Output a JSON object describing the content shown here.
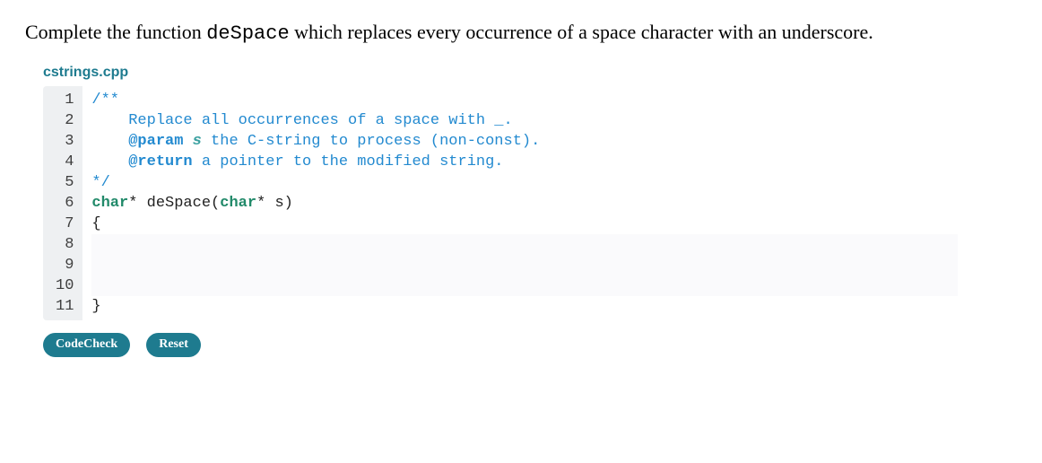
{
  "prompt": {
    "prefix": "Complete the function ",
    "func": "deSpace",
    "suffix": " which replaces every occurrence of a space character with an underscore."
  },
  "filename": "cstrings.cpp",
  "lines": [
    {
      "n": "1",
      "edit": false,
      "tokens": [
        {
          "cls": "tok-comment",
          "t": "/**"
        }
      ]
    },
    {
      "n": "2",
      "edit": false,
      "tokens": [
        {
          "cls": "tok-comment",
          "t": "    Replace all occurrences of a space with _."
        }
      ]
    },
    {
      "n": "3",
      "edit": false,
      "tokens": [
        {
          "cls": "tok-comment",
          "t": "    "
        },
        {
          "cls": "tok-docstrong",
          "t": "@param"
        },
        {
          "cls": "tok-comment",
          "t": " "
        },
        {
          "cls": "tok-doccode",
          "t": "s"
        },
        {
          "cls": "tok-comment",
          "t": " the C-string to process (non-const)."
        }
      ]
    },
    {
      "n": "4",
      "edit": false,
      "tokens": [
        {
          "cls": "tok-comment",
          "t": "    "
        },
        {
          "cls": "tok-docstrong",
          "t": "@return"
        },
        {
          "cls": "tok-comment",
          "t": " a pointer to the modified string."
        }
      ]
    },
    {
      "n": "5",
      "edit": false,
      "tokens": [
        {
          "cls": "tok-comment",
          "t": "*/"
        }
      ]
    },
    {
      "n": "6",
      "edit": false,
      "tokens": [
        {
          "cls": "tok-kw",
          "t": "char"
        },
        {
          "cls": "tok-plain",
          "t": "* deSpace("
        },
        {
          "cls": "tok-kw",
          "t": "char"
        },
        {
          "cls": "tok-plain",
          "t": "* s)"
        }
      ]
    },
    {
      "n": "7",
      "edit": false,
      "tokens": [
        {
          "cls": "tok-plain",
          "t": "{"
        }
      ]
    },
    {
      "n": "8",
      "edit": true,
      "tokens": [
        {
          "cls": "tok-plain",
          "t": ""
        }
      ]
    },
    {
      "n": "9",
      "edit": true,
      "tokens": [
        {
          "cls": "tok-plain",
          "t": ""
        }
      ]
    },
    {
      "n": "10",
      "edit": true,
      "tokens": [
        {
          "cls": "tok-plain",
          "t": ""
        }
      ]
    },
    {
      "n": "11",
      "edit": false,
      "tokens": [
        {
          "cls": "tok-plain",
          "t": "}"
        }
      ]
    }
  ],
  "buttons": {
    "codecheck": "CodeCheck",
    "reset": "Reset"
  }
}
